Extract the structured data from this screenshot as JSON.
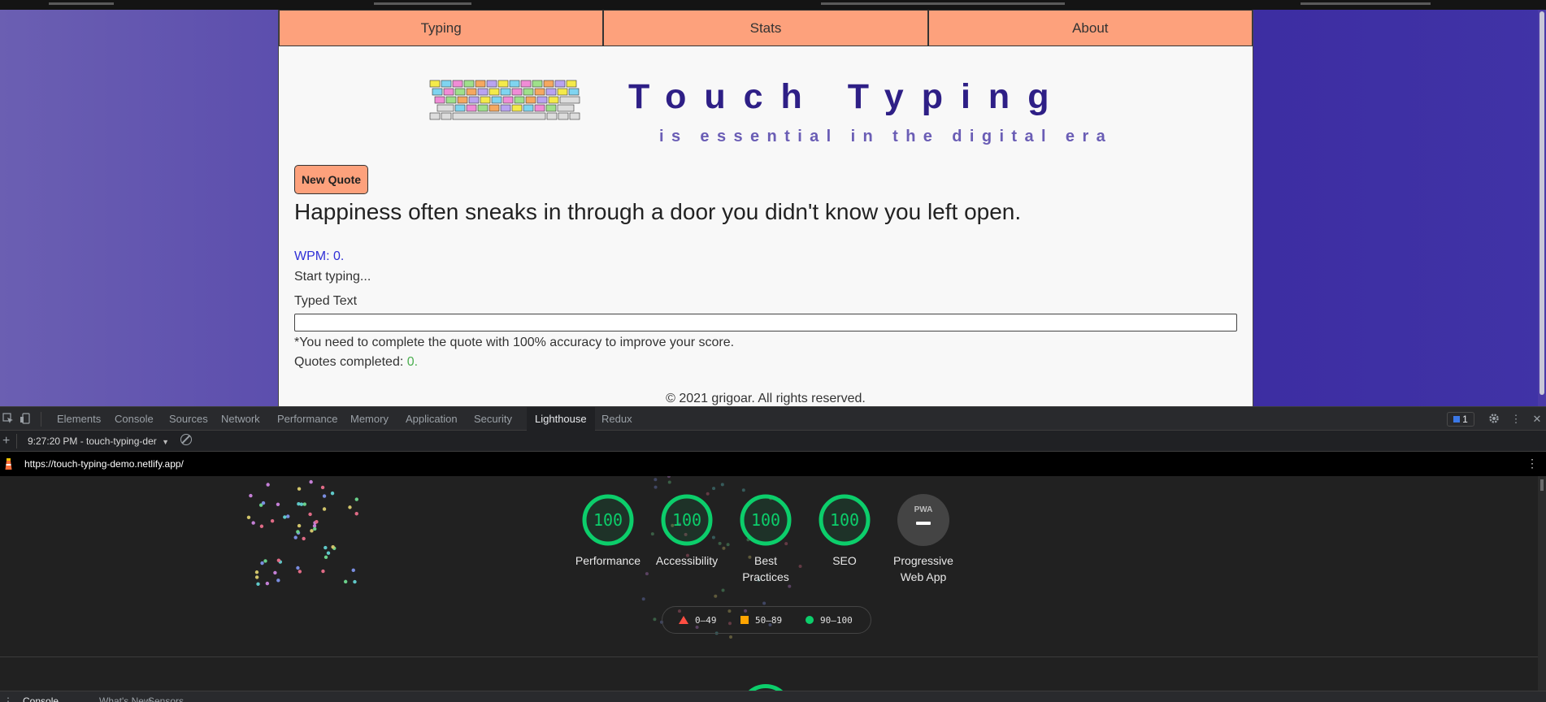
{
  "app": {
    "nav": [
      "Typing",
      "Stats",
      "About"
    ],
    "hero": {
      "title": "Touch Typing",
      "subtitle": "is essential in the digital era"
    },
    "new_quote_label": "New Quote",
    "quote": "Happiness often sneaks in through a door you didn't know you left open.",
    "wpm_label": "WPM: 0.",
    "status_text": "Start typing...",
    "typed_text_label": "Typed Text",
    "typed_text_value": "",
    "accuracy_note": "*You need to complete the quote with 100% accuracy to improve your score.",
    "quotes_completed_label": "Quotes completed:",
    "quotes_completed_count": "0.",
    "footer": "© 2021 grigoar. All rights reserved."
  },
  "devtools": {
    "tabs": [
      "Elements",
      "Console",
      "Sources",
      "Network",
      "Performance",
      "Memory",
      "Application",
      "Security",
      "Lighthouse",
      "Redux"
    ],
    "active_tab": "Lighthouse",
    "issues_count": "1",
    "report_selector": "9:27:20 PM - touch-typing-der",
    "url": "https://touch-typing-demo.netlify.app/",
    "scores": [
      {
        "label": "Performance",
        "value": "100"
      },
      {
        "label": "Accessibility",
        "value": "100"
      },
      {
        "label": "Best Practices",
        "value": "100"
      },
      {
        "label": "SEO",
        "value": "100"
      }
    ],
    "pwa": {
      "label": "Progressive Web App",
      "badge": "PWA"
    },
    "legend": [
      "0–49",
      "50–89",
      "90–100"
    ],
    "drawer_tabs": [
      "Console",
      "What's New",
      "Sensors"
    ],
    "colors": {
      "pass": "#0cce6b",
      "average": "#ffa400",
      "fail": "#ff4e42"
    }
  }
}
